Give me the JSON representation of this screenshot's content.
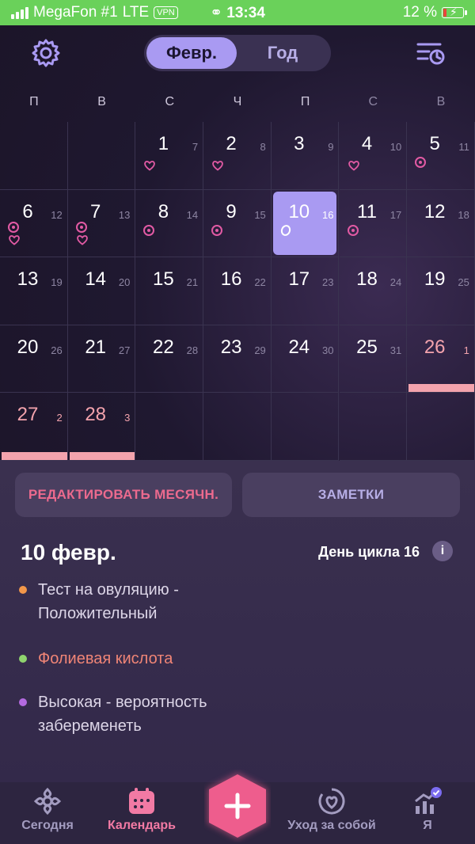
{
  "status_bar": {
    "carrier": "MegaFon #1",
    "network": "LTE",
    "vpn": "VPN",
    "time": "13:34",
    "battery": "12 %"
  },
  "header": {
    "month_tab": "Февр.",
    "year_tab": "Год"
  },
  "weekdays": [
    "П",
    "В",
    "С",
    "Ч",
    "П",
    "С",
    "В"
  ],
  "calendar": {
    "days": [
      {
        "day": "1",
        "cycle": "7"
      },
      {
        "day": "2",
        "cycle": "8"
      },
      {
        "day": "3",
        "cycle": "9"
      },
      {
        "day": "4",
        "cycle": "10"
      },
      {
        "day": "5",
        "cycle": "11"
      },
      {
        "day": "6",
        "cycle": "12"
      },
      {
        "day": "7",
        "cycle": "13"
      },
      {
        "day": "8",
        "cycle": "14"
      },
      {
        "day": "9",
        "cycle": "15"
      },
      {
        "day": "10",
        "cycle": "16"
      },
      {
        "day": "11",
        "cycle": "17"
      },
      {
        "day": "12",
        "cycle": "18"
      },
      {
        "day": "13",
        "cycle": "19"
      },
      {
        "day": "14",
        "cycle": "20"
      },
      {
        "day": "15",
        "cycle": "21"
      },
      {
        "day": "16",
        "cycle": "22"
      },
      {
        "day": "17",
        "cycle": "23"
      },
      {
        "day": "18",
        "cycle": "24"
      },
      {
        "day": "19",
        "cycle": "25"
      },
      {
        "day": "20",
        "cycle": "26"
      },
      {
        "day": "21",
        "cycle": "27"
      },
      {
        "day": "22",
        "cycle": "28"
      },
      {
        "day": "23",
        "cycle": "29"
      },
      {
        "day": "24",
        "cycle": "30"
      },
      {
        "day": "25",
        "cycle": "31"
      },
      {
        "day": "26",
        "cycle": "1"
      },
      {
        "day": "27",
        "cycle": "2"
      },
      {
        "day": "28",
        "cycle": "3"
      }
    ]
  },
  "actions": {
    "edit_label": "РЕДАКТИРОВАТЬ МЕСЯЧН.",
    "notes_label": "ЗАМЕТКИ"
  },
  "details": {
    "date": "10 февр.",
    "cycle_day": "День цикла 16",
    "info": "i",
    "notes": [
      "Тест на овуляцию - Положительный",
      "Фолиевая кислота",
      "Высокая - вероятность забеременеть"
    ]
  },
  "tabs": {
    "today": "Сегодня",
    "calendar": "Календарь",
    "care": "Уход за собой",
    "me": "Я"
  },
  "colors": {
    "accent": "#a99af2",
    "period": "#f3a3ad",
    "pink": "#f27aa4",
    "status_green": "#6ad15a"
  }
}
